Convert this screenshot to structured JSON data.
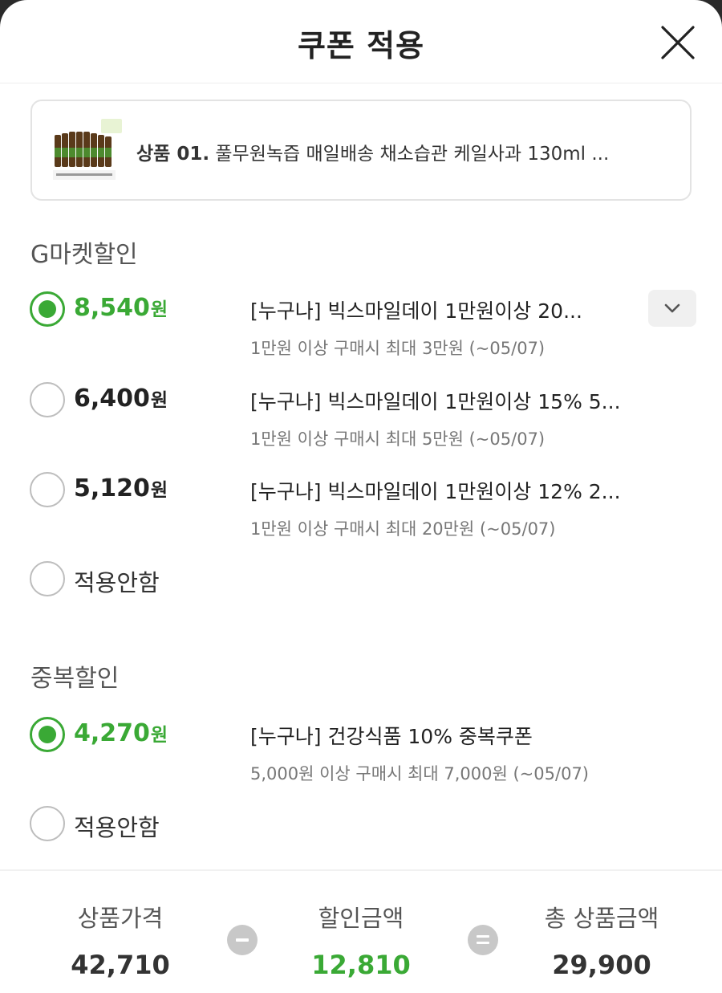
{
  "header": {
    "title": "쿠폰 적용",
    "close_icon": "close-icon"
  },
  "product": {
    "number": "상품 01.",
    "name": "풀무원녹즙 매일배송 채소습관 케일사과 130ml ...",
    "thumbnail_icon": "juice-bottles-thumbnail"
  },
  "gmarket_section": {
    "title": "G마켓할인",
    "options": [
      {
        "amount": "8,540",
        "unit": "원",
        "selected": true,
        "name": "[누구나] 빅스마일데이 1만원이상 20...",
        "desc": "1만원 이상 구매시 최대 3만원 (~05/07)"
      },
      {
        "amount": "6,400",
        "unit": "원",
        "selected": false,
        "name": "[누구나] 빅스마일데이 1만원이상 15% 5...",
        "desc": "1만원 이상 구매시 최대 5만원 (~05/07)"
      },
      {
        "amount": "5,120",
        "unit": "원",
        "selected": false,
        "name": "[누구나] 빅스마일데이 1만원이상 12% 2...",
        "desc": "1만원 이상 구매시 최대 20만원 (~05/07)"
      }
    ],
    "none_label": "적용안함"
  },
  "duplicate_section": {
    "title": "중복할인",
    "options": [
      {
        "amount": "4,270",
        "unit": "원",
        "selected": true,
        "name": "[누구나] 건강식품 10% 중복쿠폰",
        "desc": "5,000원 이상 구매시 최대 7,000원 (~05/07)"
      }
    ],
    "none_label": "적용안함"
  },
  "summary": {
    "price_label": "상품가격",
    "price": "42,710",
    "discount_label": "할인금액",
    "discount": "12,810",
    "total_label": "총 상품금액",
    "total": "29,900"
  },
  "colors": {
    "accent": "#3aa935",
    "text": "#222222",
    "muted": "#777777",
    "border": "#e3e3e3"
  }
}
